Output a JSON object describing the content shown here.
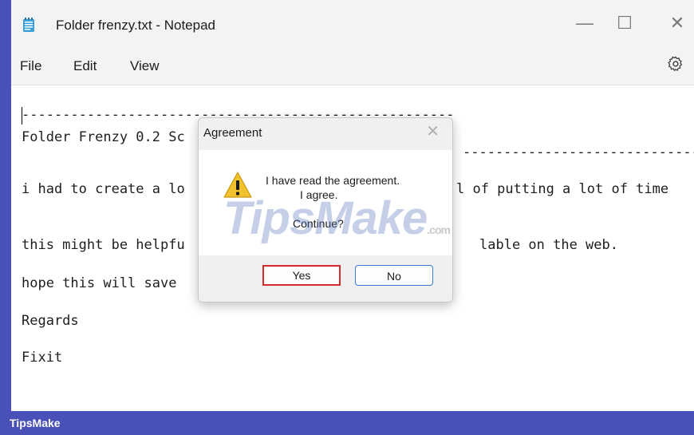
{
  "window": {
    "title": "Folder frenzy.txt - Notepad",
    "minimize_symbol": "—",
    "maximize_symbol": "☐",
    "close_symbol": "✕"
  },
  "menu": {
    "items": [
      "File",
      "Edit",
      "View"
    ],
    "settings_icon": "gear-icon"
  },
  "editor": {
    "lines": [
      "-----------------------------------------------------",
      "Folder Frenzy 0.2 Sc",
      "                                  ------------------",
      "i had to create a lo",
      "this might be helpfu",
      "hope this will save",
      "Regards",
      "Fixit"
    ],
    "right_fragments": [
      "l of putting a lot of time",
      "lable on the web."
    ],
    "right_dashes": "-----------------------------"
  },
  "dialog": {
    "title": "Agreement",
    "message_line1": "I have read the agreement.",
    "message_line2": "I agree.",
    "question": "Continue?",
    "yes_label": "Yes",
    "no_label": "No",
    "icon": "warning-icon",
    "close_symbol": "✕"
  },
  "watermark": {
    "text": "TipsMake",
    "suffix": ".com"
  },
  "footer": {
    "brand": "TipsMake"
  },
  "colors": {
    "accent": "#4950b8",
    "highlight_border": "#d62b2b",
    "default_button_border": "#3a7bd5",
    "warning": "#f2c12e"
  }
}
